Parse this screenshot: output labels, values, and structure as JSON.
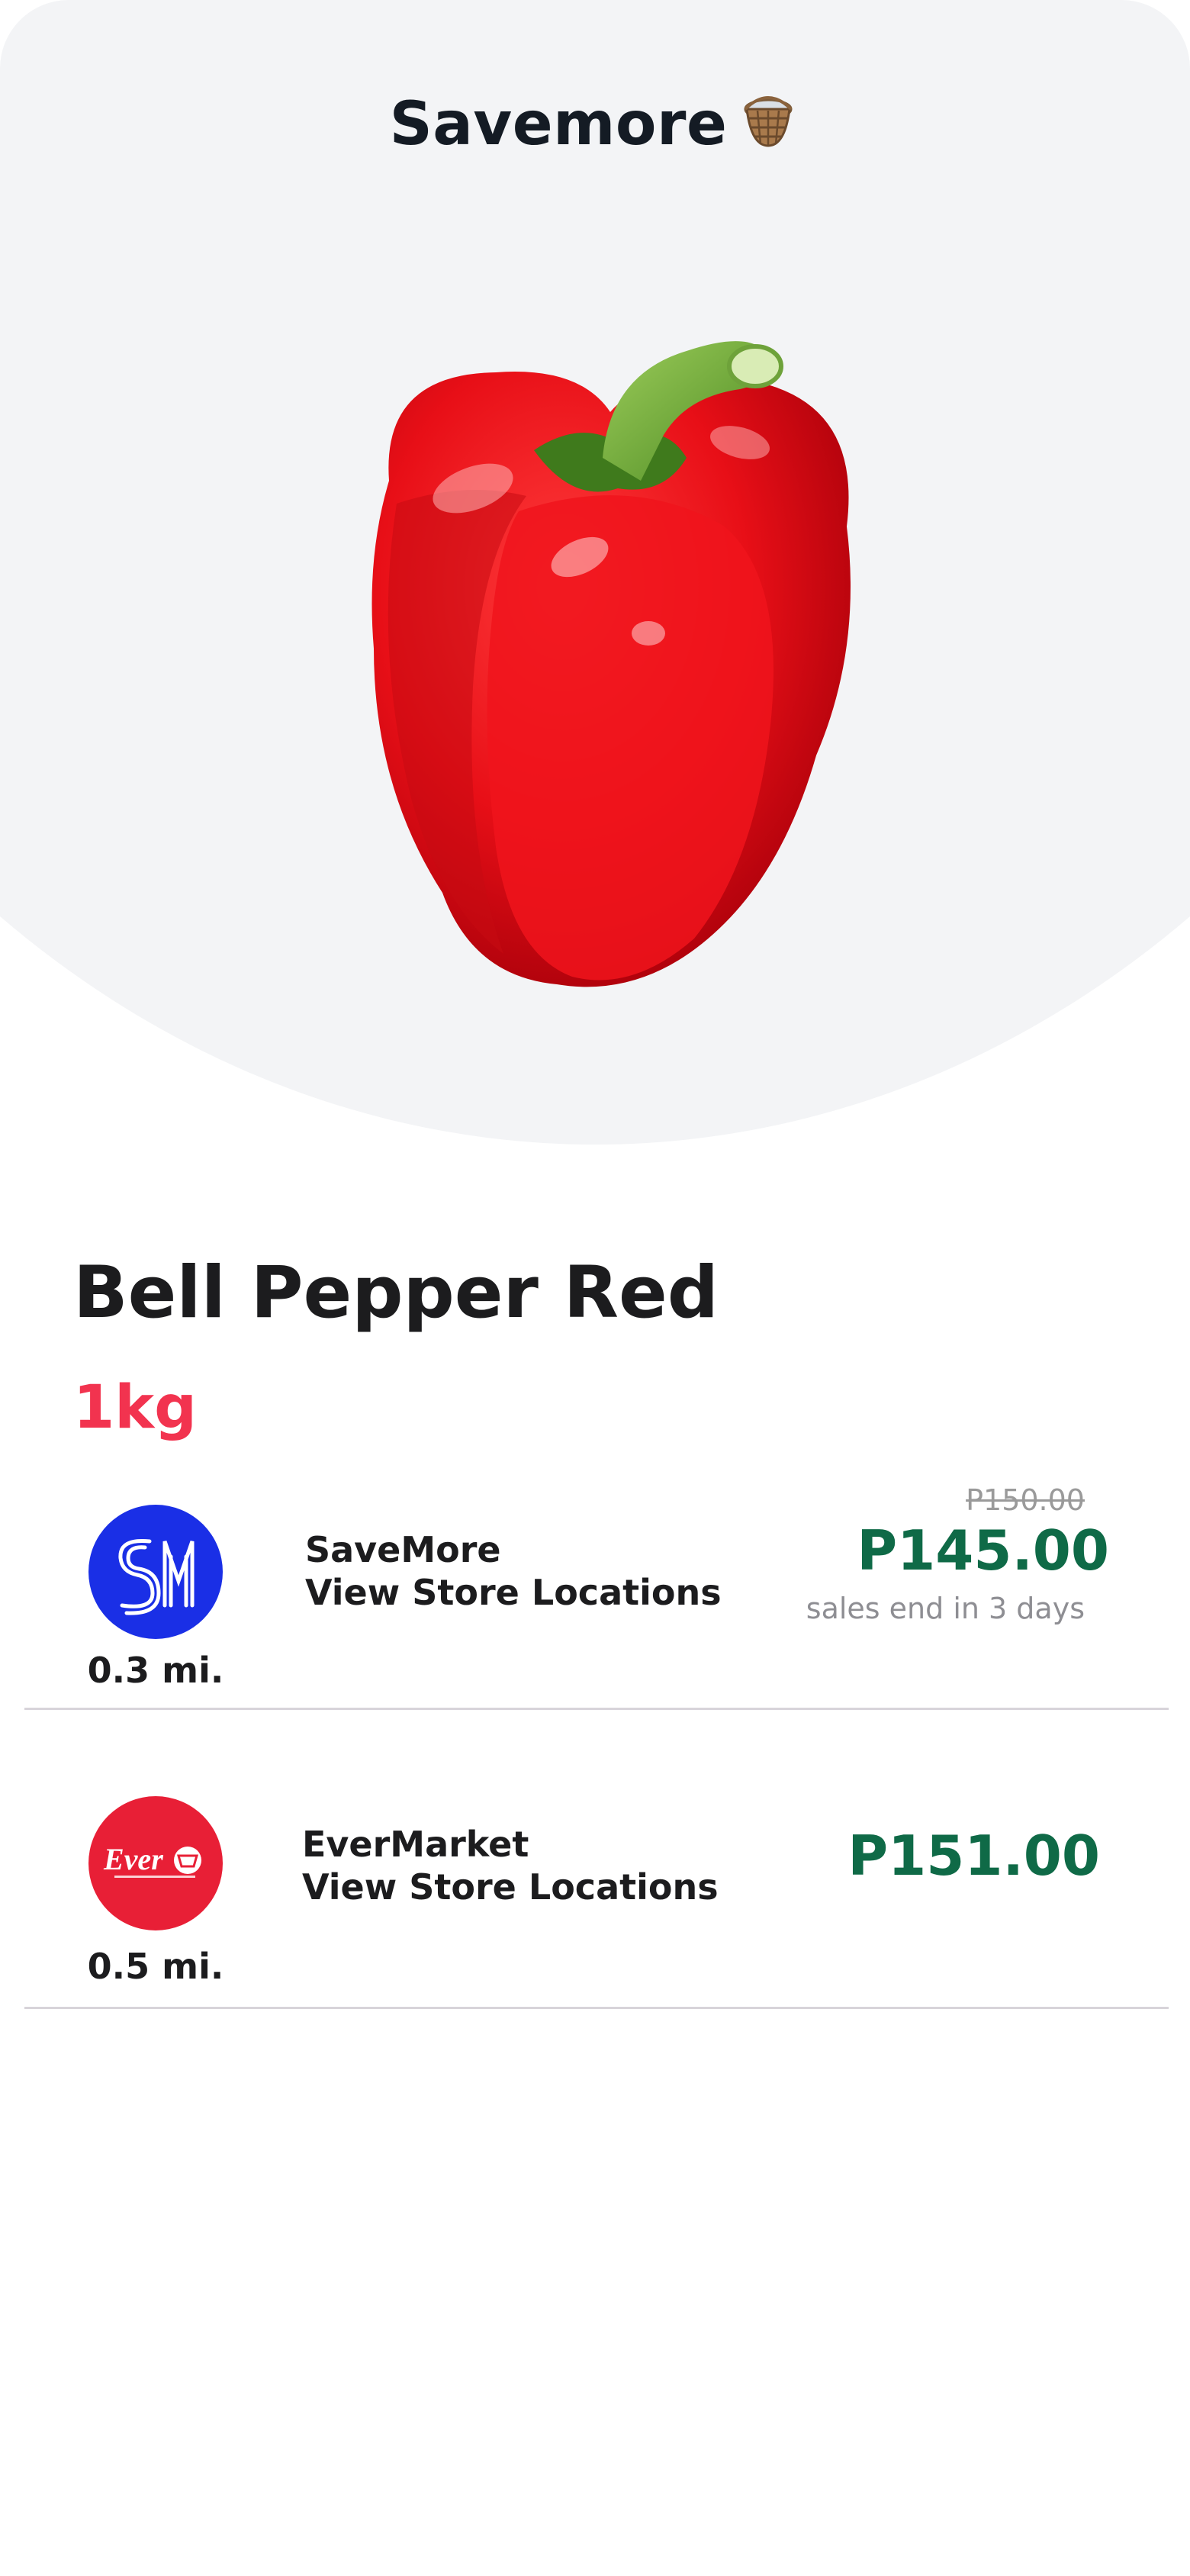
{
  "header": {
    "title": "Savemore",
    "title_icon": "basket-icon"
  },
  "product": {
    "name": "Bell Pepper Red",
    "weight": "1kg",
    "image_name": "red-bell-pepper-image"
  },
  "stores": [
    {
      "name": "SaveMore",
      "link_label": "View Store Locations",
      "distance": "0.3 mi.",
      "logo_icon": "sm-logo-icon",
      "logo_color": "#1a2fe6",
      "old_price": "P150.00",
      "price": "P145.00",
      "sale_note": "sales end in 3 days"
    },
    {
      "name": "EverMarket",
      "link_label": "View Store Locations",
      "distance": "0.5 mi.",
      "logo_icon": "ever-logo-icon",
      "logo_color": "#e81f36",
      "price": "P151.00"
    }
  ],
  "colors": {
    "price_green": "#0f6a47",
    "weight_red": "#f2334f",
    "hero_bg": "#f3f4f6"
  }
}
